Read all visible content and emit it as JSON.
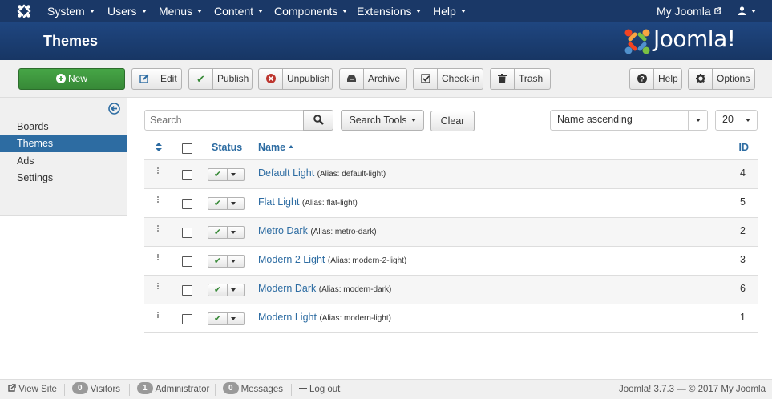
{
  "topnav": {
    "menus": [
      "System",
      "Users",
      "Menus",
      "Content",
      "Components",
      "Extensions",
      "Help"
    ],
    "site_link": "My Joomla"
  },
  "header": {
    "title": "Themes",
    "brand": "Joomla!"
  },
  "toolbar": {
    "new": "New",
    "edit": "Edit",
    "publish": "Publish",
    "unpublish": "Unpublish",
    "archive": "Archive",
    "checkin": "Check-in",
    "trash": "Trash",
    "help": "Help",
    "options": "Options"
  },
  "sidebar": {
    "items": [
      {
        "label": "Boards",
        "active": false
      },
      {
        "label": "Themes",
        "active": true
      },
      {
        "label": "Ads",
        "active": false
      },
      {
        "label": "Settings",
        "active": false
      }
    ]
  },
  "filters": {
    "search_placeholder": "Search",
    "search_tools": "Search Tools",
    "clear": "Clear",
    "ordering": "Name ascending",
    "limit": "20"
  },
  "table": {
    "headers": {
      "status": "Status",
      "name": "Name",
      "id": "ID"
    }
  },
  "themes": {
    "rows": [
      {
        "name": "Default Light",
        "alias": "(Alias: default-light)",
        "id": "4"
      },
      {
        "name": "Flat Light",
        "alias": "(Alias: flat-light)",
        "id": "5"
      },
      {
        "name": "Metro Dark",
        "alias": "(Alias: metro-dark)",
        "id": "2"
      },
      {
        "name": "Modern 2 Light",
        "alias": "(Alias: modern-2-light)",
        "id": "3"
      },
      {
        "name": "Modern Dark",
        "alias": "(Alias: modern-dark)",
        "id": "6"
      },
      {
        "name": "Modern Light",
        "alias": "(Alias: modern-light)",
        "id": "1"
      }
    ]
  },
  "footer": {
    "view_site": "View Site",
    "visitors_count": "0",
    "visitors": "Visitors",
    "admin_count": "1",
    "admin": "Administrator",
    "messages_count": "0",
    "messages": "Messages",
    "logout": "Log out",
    "copyright": "Joomla! 3.7.3  —  © 2017 My Joomla"
  },
  "colors": {
    "navbar": "#1a3867",
    "header": "#1c3d72",
    "accent": "#2d6ca2",
    "success": "#46a546"
  },
  "icons": {
    "logo": "joomla-logo-icon",
    "external": "external-link-icon",
    "user": "user-icon",
    "collapse": "arrow-left-circle-icon"
  }
}
